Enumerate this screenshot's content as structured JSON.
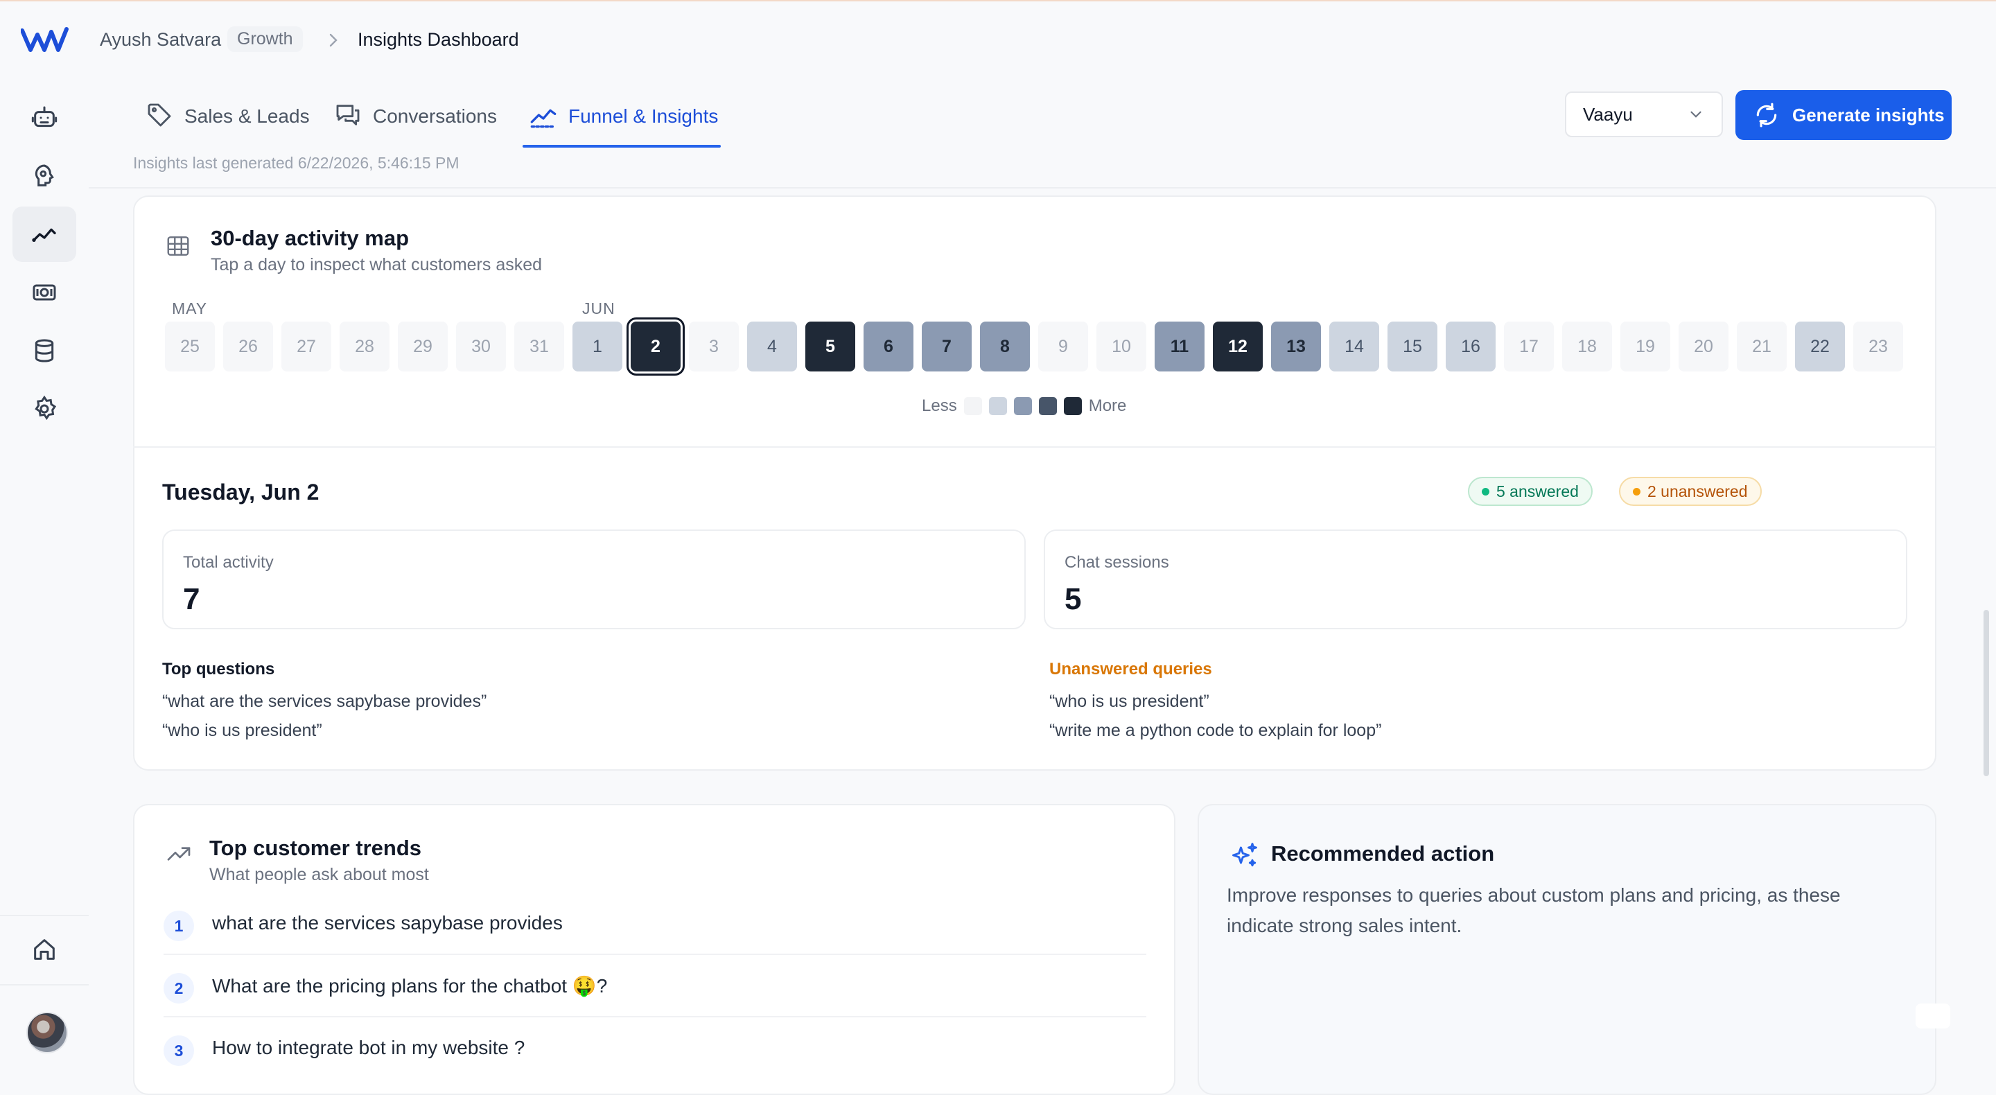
{
  "header": {
    "user": "Ayush Satvara",
    "workspace": "Growth",
    "page": "Insights Dashboard"
  },
  "sidebar": {
    "items": [
      {
        "name": "bot-icon"
      },
      {
        "name": "brain-icon"
      },
      {
        "name": "insights-icon",
        "active": true
      },
      {
        "name": "money-icon"
      },
      {
        "name": "database-icon"
      },
      {
        "name": "settings-icon"
      },
      {
        "name": "home-icon"
      }
    ]
  },
  "tabs": [
    {
      "label": "Sales & Leads",
      "icon": "tag-icon"
    },
    {
      "label": "Conversations",
      "icon": "chat-icon"
    },
    {
      "label": "Funnel & Insights",
      "icon": "trend-icon",
      "active": true
    }
  ],
  "last_generated": "Insights last generated 6/22/2026, 5:46:15 PM",
  "bot_select": {
    "value": "Vaayu"
  },
  "generate_button": "Generate insights",
  "activity_map": {
    "title": "30-day activity map",
    "subtitle": "Tap a day to inspect what customers asked",
    "month_may": "MAY",
    "month_jun": "JUN",
    "days": [
      {
        "label": "25",
        "level": 0
      },
      {
        "label": "26",
        "level": 0
      },
      {
        "label": "27",
        "level": 0
      },
      {
        "label": "28",
        "level": 0
      },
      {
        "label": "29",
        "level": 0
      },
      {
        "label": "30",
        "level": 0
      },
      {
        "label": "31",
        "level": 0
      },
      {
        "label": "1",
        "level": 1
      },
      {
        "label": "2",
        "level": 4,
        "selected": true
      },
      {
        "label": "3",
        "level": 0
      },
      {
        "label": "4",
        "level": 1
      },
      {
        "label": "5",
        "level": 4
      },
      {
        "label": "6",
        "level": 2
      },
      {
        "label": "7",
        "level": 2
      },
      {
        "label": "8",
        "level": 2
      },
      {
        "label": "9",
        "level": 0
      },
      {
        "label": "10",
        "level": 0
      },
      {
        "label": "11",
        "level": 2
      },
      {
        "label": "12",
        "level": 4
      },
      {
        "label": "13",
        "level": 2
      },
      {
        "label": "14",
        "level": 1
      },
      {
        "label": "15",
        "level": 1
      },
      {
        "label": "16",
        "level": 1
      },
      {
        "label": "17",
        "level": 0
      },
      {
        "label": "18",
        "level": 0
      },
      {
        "label": "19",
        "level": 0
      },
      {
        "label": "20",
        "level": 0
      },
      {
        "label": "21",
        "level": 0
      },
      {
        "label": "22",
        "level": 1
      },
      {
        "label": "23",
        "level": 0
      }
    ],
    "legend_less": "Less",
    "legend_more": "More",
    "legend_colors": [
      "#f3f4f6",
      "#cdd5e0",
      "#8b9ab2",
      "#475569",
      "#1f2937"
    ]
  },
  "day_detail": {
    "date": "Tuesday, Jun 2",
    "answered": "5 answered",
    "unanswered": "2 unanswered",
    "total_activity_label": "Total activity",
    "total_activity_value": "7",
    "chat_sessions_label": "Chat sessions",
    "chat_sessions_value": "5",
    "top_questions_label": "Top questions",
    "top_questions": [
      "“what are the services sapybase provides”",
      "“who is us president”"
    ],
    "unanswered_label": "Unanswered queries",
    "unanswered_queries": [
      "“who is us president”",
      "“write me a python code to explain for loop”"
    ]
  },
  "trends": {
    "title": "Top customer trends",
    "subtitle": "What people ask about most",
    "items": [
      {
        "num": "1",
        "text": "what are the services sapybase provides"
      },
      {
        "num": "2",
        "text": "What are the pricing plans for the chatbot 🤑?"
      },
      {
        "num": "3",
        "text": "How to integrate bot in my website ?"
      }
    ]
  },
  "recommended": {
    "title": "Recommended action",
    "text": "Improve responses to queries about custom plans and pricing, as these indicate strong sales intent."
  },
  "colors": {
    "accent": "#1a5eea",
    "answered": "#047857",
    "unanswered": "#b45309"
  }
}
